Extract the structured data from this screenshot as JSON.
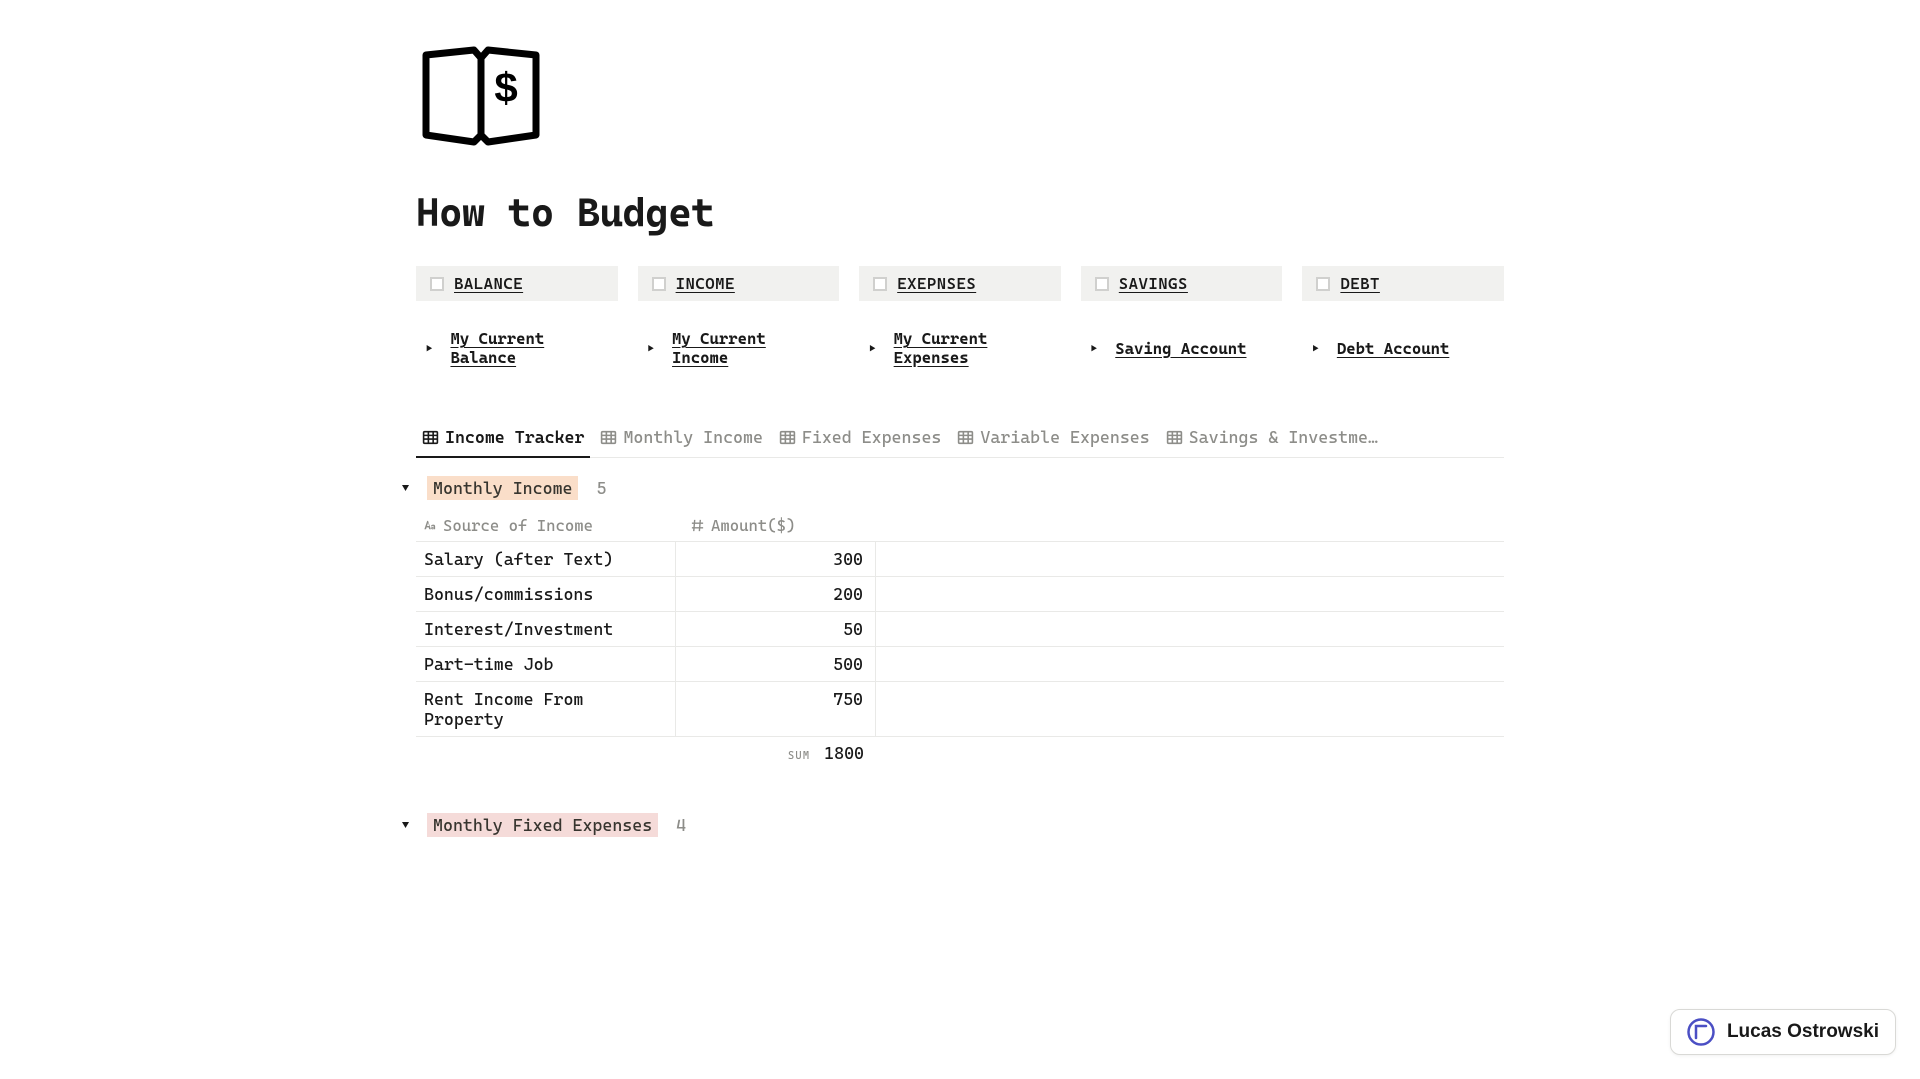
{
  "page": {
    "title": "How to Budget"
  },
  "categories": [
    {
      "label": "BALANCE"
    },
    {
      "label": "INCOME"
    },
    {
      "label": "EXEPNSES"
    },
    {
      "label": "SAVINGS"
    },
    {
      "label": "DEBT"
    }
  ],
  "toggles": [
    {
      "label": "My Current Balance"
    },
    {
      "label": "My Current Income"
    },
    {
      "label": "My Current Expenses"
    },
    {
      "label": "Saving Account"
    },
    {
      "label": "Debt Account"
    }
  ],
  "tabs": [
    {
      "label": "Income Tracker",
      "active": true
    },
    {
      "label": "Monthly Income",
      "active": false
    },
    {
      "label": "Fixed Expenses",
      "active": false
    },
    {
      "label": "Variable Expenses",
      "active": false
    },
    {
      "label": "Savings & Investme…",
      "active": false
    }
  ],
  "group1": {
    "name": "Monthly Income",
    "count": "5",
    "columns": {
      "source": "Source of Income",
      "amount": "Amount($)"
    },
    "rows": [
      {
        "source": "Salary (after Text)",
        "amount": "300"
      },
      {
        "source": "Bonus/commissions",
        "amount": "200"
      },
      {
        "source": "Interest/Investment",
        "amount": "50"
      },
      {
        "source": "Part-time Job",
        "amount": "500"
      },
      {
        "source": "Rent Income From Property",
        "amount": "750"
      }
    ],
    "sum_label": "SUM",
    "sum_value": "1800"
  },
  "group2": {
    "name": "Monthly Fixed Expenses",
    "count": "4"
  },
  "user": {
    "name": "Lucas Ostrowski"
  }
}
